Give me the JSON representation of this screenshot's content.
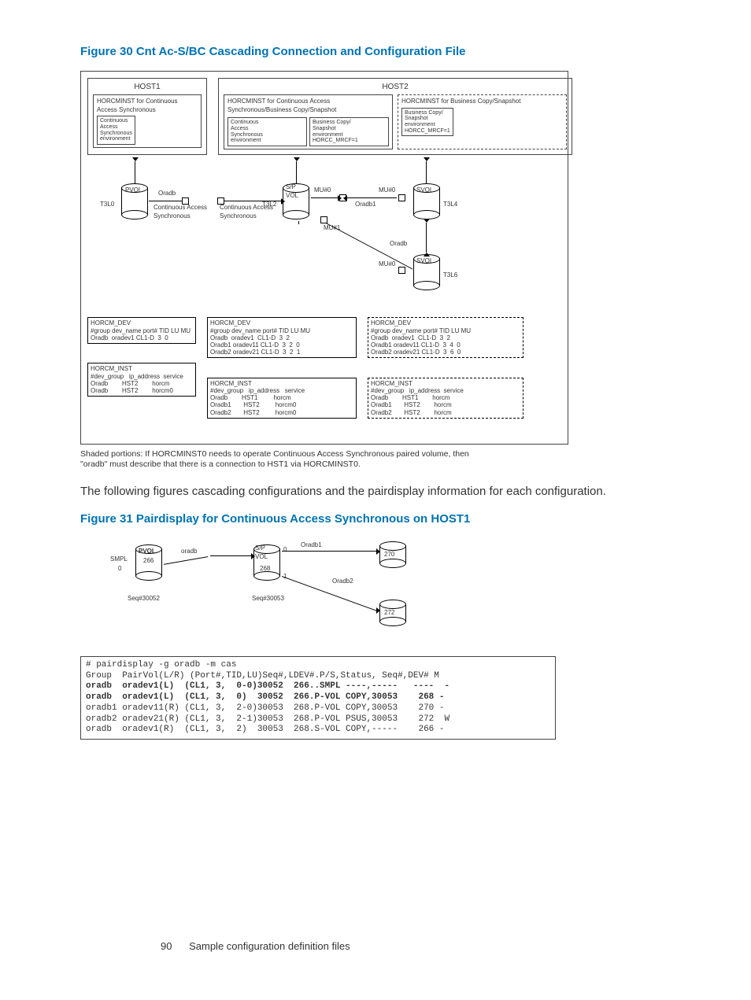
{
  "figure30": {
    "title": "Figure 30 Cnt Ac-S/BC Cascading Connection and Configuration File",
    "host1": {
      "name": "HOST1",
      "instance": "HORCMINST for Continuous\nAccess Synchronous",
      "env": "Continuous\nAccess\nSynchronous\nenvironment"
    },
    "host2": {
      "name": "HOST2",
      "instanceA": "HORCMINST for Continuous Access\nSynchronous/Business Copy/Snapshot",
      "envA1": "Continuous\nAccess\nSynchronous\nenvironment",
      "envA2": "Business Copy/\nSnapshot\nenvironment\nHORCC_MRCF=1",
      "instanceB": "HORCMINST for Business Copy/Snapshot",
      "envB": "Business Copy/\nSnapshot\nenvironment\nHORCC_MRCF=1"
    },
    "vols": {
      "pvol": "PVOL",
      "spvol": "S/P\nVOL",
      "svol": "SVOL",
      "t3l0": "T3L0",
      "t3l2": "T3L2",
      "t3l4": "T3L4",
      "t3l6": "T3L6",
      "mu0": "MU#0",
      "mu1": "MU#1",
      "oradb": "Oradb",
      "oradb1": "Oradb1",
      "oradb2": "Oradb"
    },
    "ca_label_a": "Continuous Access\nSynchronous",
    "ca_label_b": "Continuous Access\nSynchronous",
    "cfg": {
      "col1": {
        "dev": "HORCM_DEV\n#group dev_name port# TID LU MU\nOradb  oradev1 CL1-D  3  0",
        "inst": "HORCM_INST\n#dev_group   ip_address  service\nOradb        HST2        horcm\nOradb        HST2        horcm0"
      },
      "col2": {
        "dev": "HORCM_DEV\n#group dev_name port# TID LU MU\nOradb  oradev1  CL1-D  3  2\nOradb1 oradev11 CL1-D  3  2  0\nOradb2 oradev21 CL1-D  3  2  1",
        "inst": "HORCM_INST\n#dev_group   ip_address   service\nOradb        HST1         horcm\nOradb1       HST2         horcm0\nOradb2       HST2         horcm0"
      },
      "col3": {
        "dev": "HORCM_DEV\n#group dev_name port# TID LU MU\nOradb  oradev1  CL1-D  3  2\nOradb1 oradev11 CL1-D  3  4  0\nOradb2 oradev21 CL1-D  3  6  0",
        "inst": "HORCM_INST\n#dev_group   ip_address  service\nOradb        HST1        horcm\nOradb1       HST2        horcm\nOradb2       HST2        horcm"
      }
    },
    "footnote": "Shaded portions: If HORCMINST0 needs to operate Continuous Access Synchronous paired volume, then \"oradb\" must describe that there is a connection to HST1 via HORCMINST0."
  },
  "body_paragraph": "The following figures cascading configurations and the pairdisplay information for each configuration.",
  "figure31": {
    "title": "Figure 31 Pairdisplay for Continuous Access Synchronous on HOST1",
    "labels": {
      "pvol": "PVOL",
      "n266": "266",
      "smpl": "SMPL",
      "zero": "0",
      "oradb": "oradb",
      "spvol": "S/P\nVOL",
      "n268": "268",
      "oradb1": "Oradb1",
      "oradb2": "Oradb2",
      "mu0": "0",
      "mu1": "1",
      "n270": "270",
      "n272": "272",
      "seq_a": "Seq#30052",
      "seq_b": "Seq#30053"
    },
    "output": "# pairdisplay -g oradb -m cas\nGroup  PairVol(L/R) (Port#,TID,LU)Seq#,LDEV#.P/S,Status, Seq#,DEV# M\noradb  oradev1(L)  (CL1, 3,  0-0)30052  266..SMPL ----,-----   ----  -\noradb  oradev1(L)  (CL1, 3,  0)  30052  266.P-VOL COPY,30053    268 -\noradb1 oradev11(R) (CL1, 3,  2-0)30053  268.P-VOL COPY,30053    270 -\noradb2 oradev21(R) (CL1, 3,  2-1)30053  268.P-VOL PSUS,30053    272  W\noradb  oradev1(R)  (CL1, 3,  2)  30053  268.S-VOL COPY,-----    266 -"
  },
  "footer": {
    "page": "90",
    "section": "Sample configuration definition files"
  }
}
